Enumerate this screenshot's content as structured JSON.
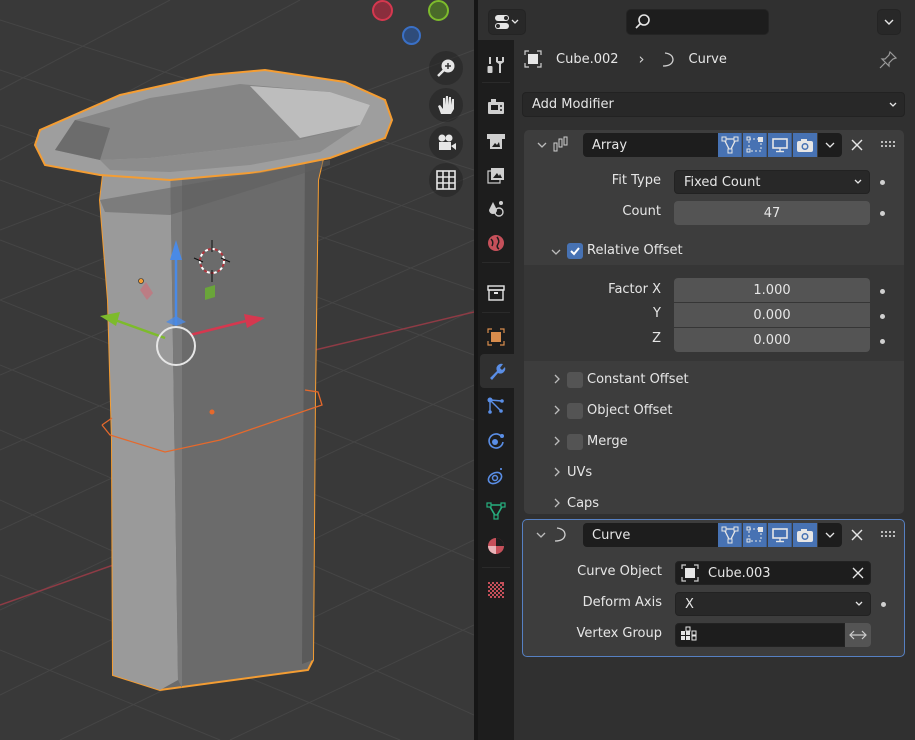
{
  "viewport": {
    "nav_buttons": [
      {
        "name": "zoom-view-button",
        "icon": "zoom-in-icon"
      },
      {
        "name": "pan-view-button",
        "icon": "hand-icon"
      },
      {
        "name": "camera-view-button",
        "icon": "camera-icon"
      },
      {
        "name": "perspective-toggle-button",
        "icon": "grid-icon"
      }
    ],
    "axis_gizmo": [
      {
        "axis": "X",
        "color": "#d5384f"
      },
      {
        "axis": "Y",
        "color": "#7dbb2c"
      },
      {
        "axis": "Z",
        "color": "#3a70c6"
      }
    ],
    "selection_outline_color": "#f49d33"
  },
  "props": {
    "editor_type_icon": "properties-editor-icon",
    "search": {
      "placeholder": "",
      "icon": "search-icon"
    },
    "breadcrumb": {
      "object": "Cube.002",
      "separator": "›",
      "modifier": "Curve"
    },
    "add_modifier_label": "Add Modifier",
    "tabs": [
      {
        "name": "tool",
        "icon": "tool-icon",
        "color": "#cfcfcf"
      },
      {
        "name": "render",
        "icon": "render-icon",
        "color": "#cfcfcf"
      },
      {
        "name": "output",
        "icon": "output-icon",
        "color": "#cfcfcf"
      },
      {
        "name": "view-layer",
        "icon": "view-layer-icon",
        "color": "#cfcfcf"
      },
      {
        "name": "scene",
        "icon": "scene-icon",
        "color": "#cfcfcf"
      },
      {
        "name": "world",
        "icon": "world-icon",
        "color": "#c5505a"
      },
      {
        "name": "collection",
        "icon": "collection-icon",
        "color": "#e6e6e6"
      },
      {
        "name": "object",
        "icon": "object-icon",
        "color": "#d88c4c"
      },
      {
        "name": "modifiers",
        "icon": "wrench-icon",
        "color": "#5a8ee6",
        "active": true
      },
      {
        "name": "particles",
        "icon": "particles-icon",
        "color": "#5a8ee6"
      },
      {
        "name": "physics",
        "icon": "physics-icon",
        "color": "#5a8ee6"
      },
      {
        "name": "constraints",
        "icon": "constraints-icon",
        "color": "#5a8ee6"
      },
      {
        "name": "data",
        "icon": "mesh-data-icon",
        "color": "#27b07f"
      },
      {
        "name": "material",
        "icon": "material-icon",
        "color": "#c5505a"
      },
      {
        "name": "texture",
        "icon": "texture-icon",
        "color": "#c5505a"
      }
    ],
    "array_modifier": {
      "name": "Array",
      "fit_type_label": "Fit Type",
      "fit_type_value": "Fixed Count",
      "count_label": "Count",
      "count_value": "47",
      "relative_offset": {
        "label": "Relative Offset",
        "checked": true,
        "factor_x_label": "Factor X",
        "factor_x": "1.000",
        "y_label": "Y",
        "y": "0.000",
        "z_label": "Z",
        "z": "0.000"
      },
      "subpanels": [
        {
          "label": "Constant Offset",
          "checkbox": true
        },
        {
          "label": "Object Offset",
          "checkbox": true
        },
        {
          "label": "Merge",
          "checkbox": true
        },
        {
          "label": "UVs",
          "checkbox": false
        },
        {
          "label": "Caps",
          "checkbox": false
        }
      ]
    },
    "curve_modifier": {
      "name": "Curve",
      "curve_object_label": "Curve Object",
      "curve_object_value": "Cube.003",
      "deform_axis_label": "Deform Axis",
      "deform_axis_value": "X",
      "vertex_group_label": "Vertex Group",
      "vertex_group_value": ""
    }
  }
}
